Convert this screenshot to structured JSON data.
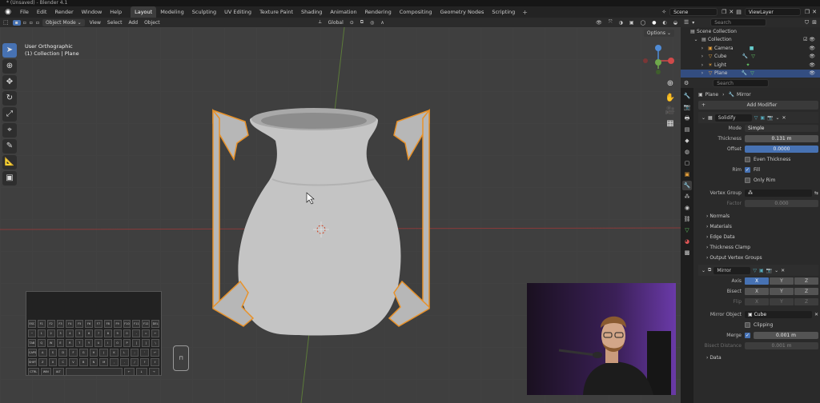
{
  "window": {
    "title": "* (Unsaved) - Blender 4.1"
  },
  "menu": [
    "File",
    "Edit",
    "Render",
    "Window",
    "Help"
  ],
  "workspaces": [
    "Layout",
    "Modeling",
    "Sculpting",
    "UV Editing",
    "Texture Paint",
    "Shading",
    "Animation",
    "Rendering",
    "Compositing",
    "Geometry Nodes",
    "Scripting"
  ],
  "active_workspace": "Layout",
  "top_right": {
    "scene": "Scene",
    "view_layer": "ViewLayer"
  },
  "viewport_header": {
    "mode": "Object Mode",
    "items": [
      "View",
      "Select",
      "Add",
      "Object"
    ],
    "transform_orientation": "Global",
    "options": "Options"
  },
  "viewport": {
    "view_name": "User Orthographic",
    "collection_info": "(1) Collection | Plane"
  },
  "outliner": {
    "search_placeholder": "Search",
    "root": "Scene Collection",
    "collection": "Collection",
    "items": [
      "Camera",
      "Cube",
      "Light",
      "Plane"
    ],
    "selected": "Plane"
  },
  "properties": {
    "search_placeholder": "Search",
    "breadcrumb_object": "Plane",
    "breadcrumb_modifier": "Mirror",
    "add_modifier": "Add Modifier",
    "solidify": {
      "name": "Solidify",
      "mode_label": "Mode",
      "mode_value": "Simple",
      "thickness_label": "Thickness",
      "thickness_value": "0.131 m",
      "offset_label": "Offset",
      "offset_value": "0.0000",
      "even_thickness": "Even Thickness",
      "rim_label": "Rim",
      "fill": "Fill",
      "only_rim": "Only Rim",
      "vertex_group_label": "Vertex Group",
      "factor_label": "Factor",
      "factor_value": "0.000",
      "subpanels": [
        "Normals",
        "Materials",
        "Edge Data",
        "Thickness Clamp",
        "Output Vertex Groups"
      ]
    },
    "mirror": {
      "name": "Mirror",
      "axis_label": "Axis",
      "bisect_label": "Bisect",
      "flip_label": "Flip",
      "axes": [
        "X",
        "Y",
        "Z"
      ],
      "mirror_object_label": "Mirror Object",
      "mirror_object_value": "Cube",
      "clipping": "Clipping",
      "merge_label": "Merge",
      "merge_value": "0.001 m",
      "bisect_distance_label": "Bisect Distance",
      "bisect_distance_value": "0.001 m",
      "data_subpanel": "Data"
    }
  },
  "keyboard_rows": [
    [
      "ESC",
      "F1",
      "F2",
      "F3",
      "F4",
      "F5",
      "F6",
      "F7",
      "F8",
      "F9",
      "F10",
      "F11",
      "F12",
      "DEL"
    ],
    [
      "~",
      "1",
      "2",
      "3",
      "4",
      "5",
      "6",
      "7",
      "8",
      "9",
      "0",
      "-",
      "=",
      "←"
    ],
    [
      "TAB",
      "Q",
      "W",
      "E",
      "R",
      "T",
      "Y",
      "U",
      "I",
      "O",
      "P",
      "[",
      "]",
      "\\"
    ],
    [
      "CAPS",
      "A",
      "S",
      "D",
      "F",
      "G",
      "H",
      "J",
      "K",
      "L",
      ";",
      "'",
      "↵"
    ],
    [
      "SHIFT",
      "Z",
      "X",
      "C",
      "V",
      "B",
      "N",
      "M",
      ",",
      ".",
      "/",
      "↑",
      "⇧"
    ],
    [
      "CTRL",
      "WIN",
      "ALT",
      "",
      "←",
      "↓",
      "→"
    ]
  ],
  "colors": {
    "accent": "#4772b3",
    "selection_outline": "#e8922a",
    "viewport_bg": "#3f3f3f",
    "panel_bg": "#2a2a2a"
  }
}
